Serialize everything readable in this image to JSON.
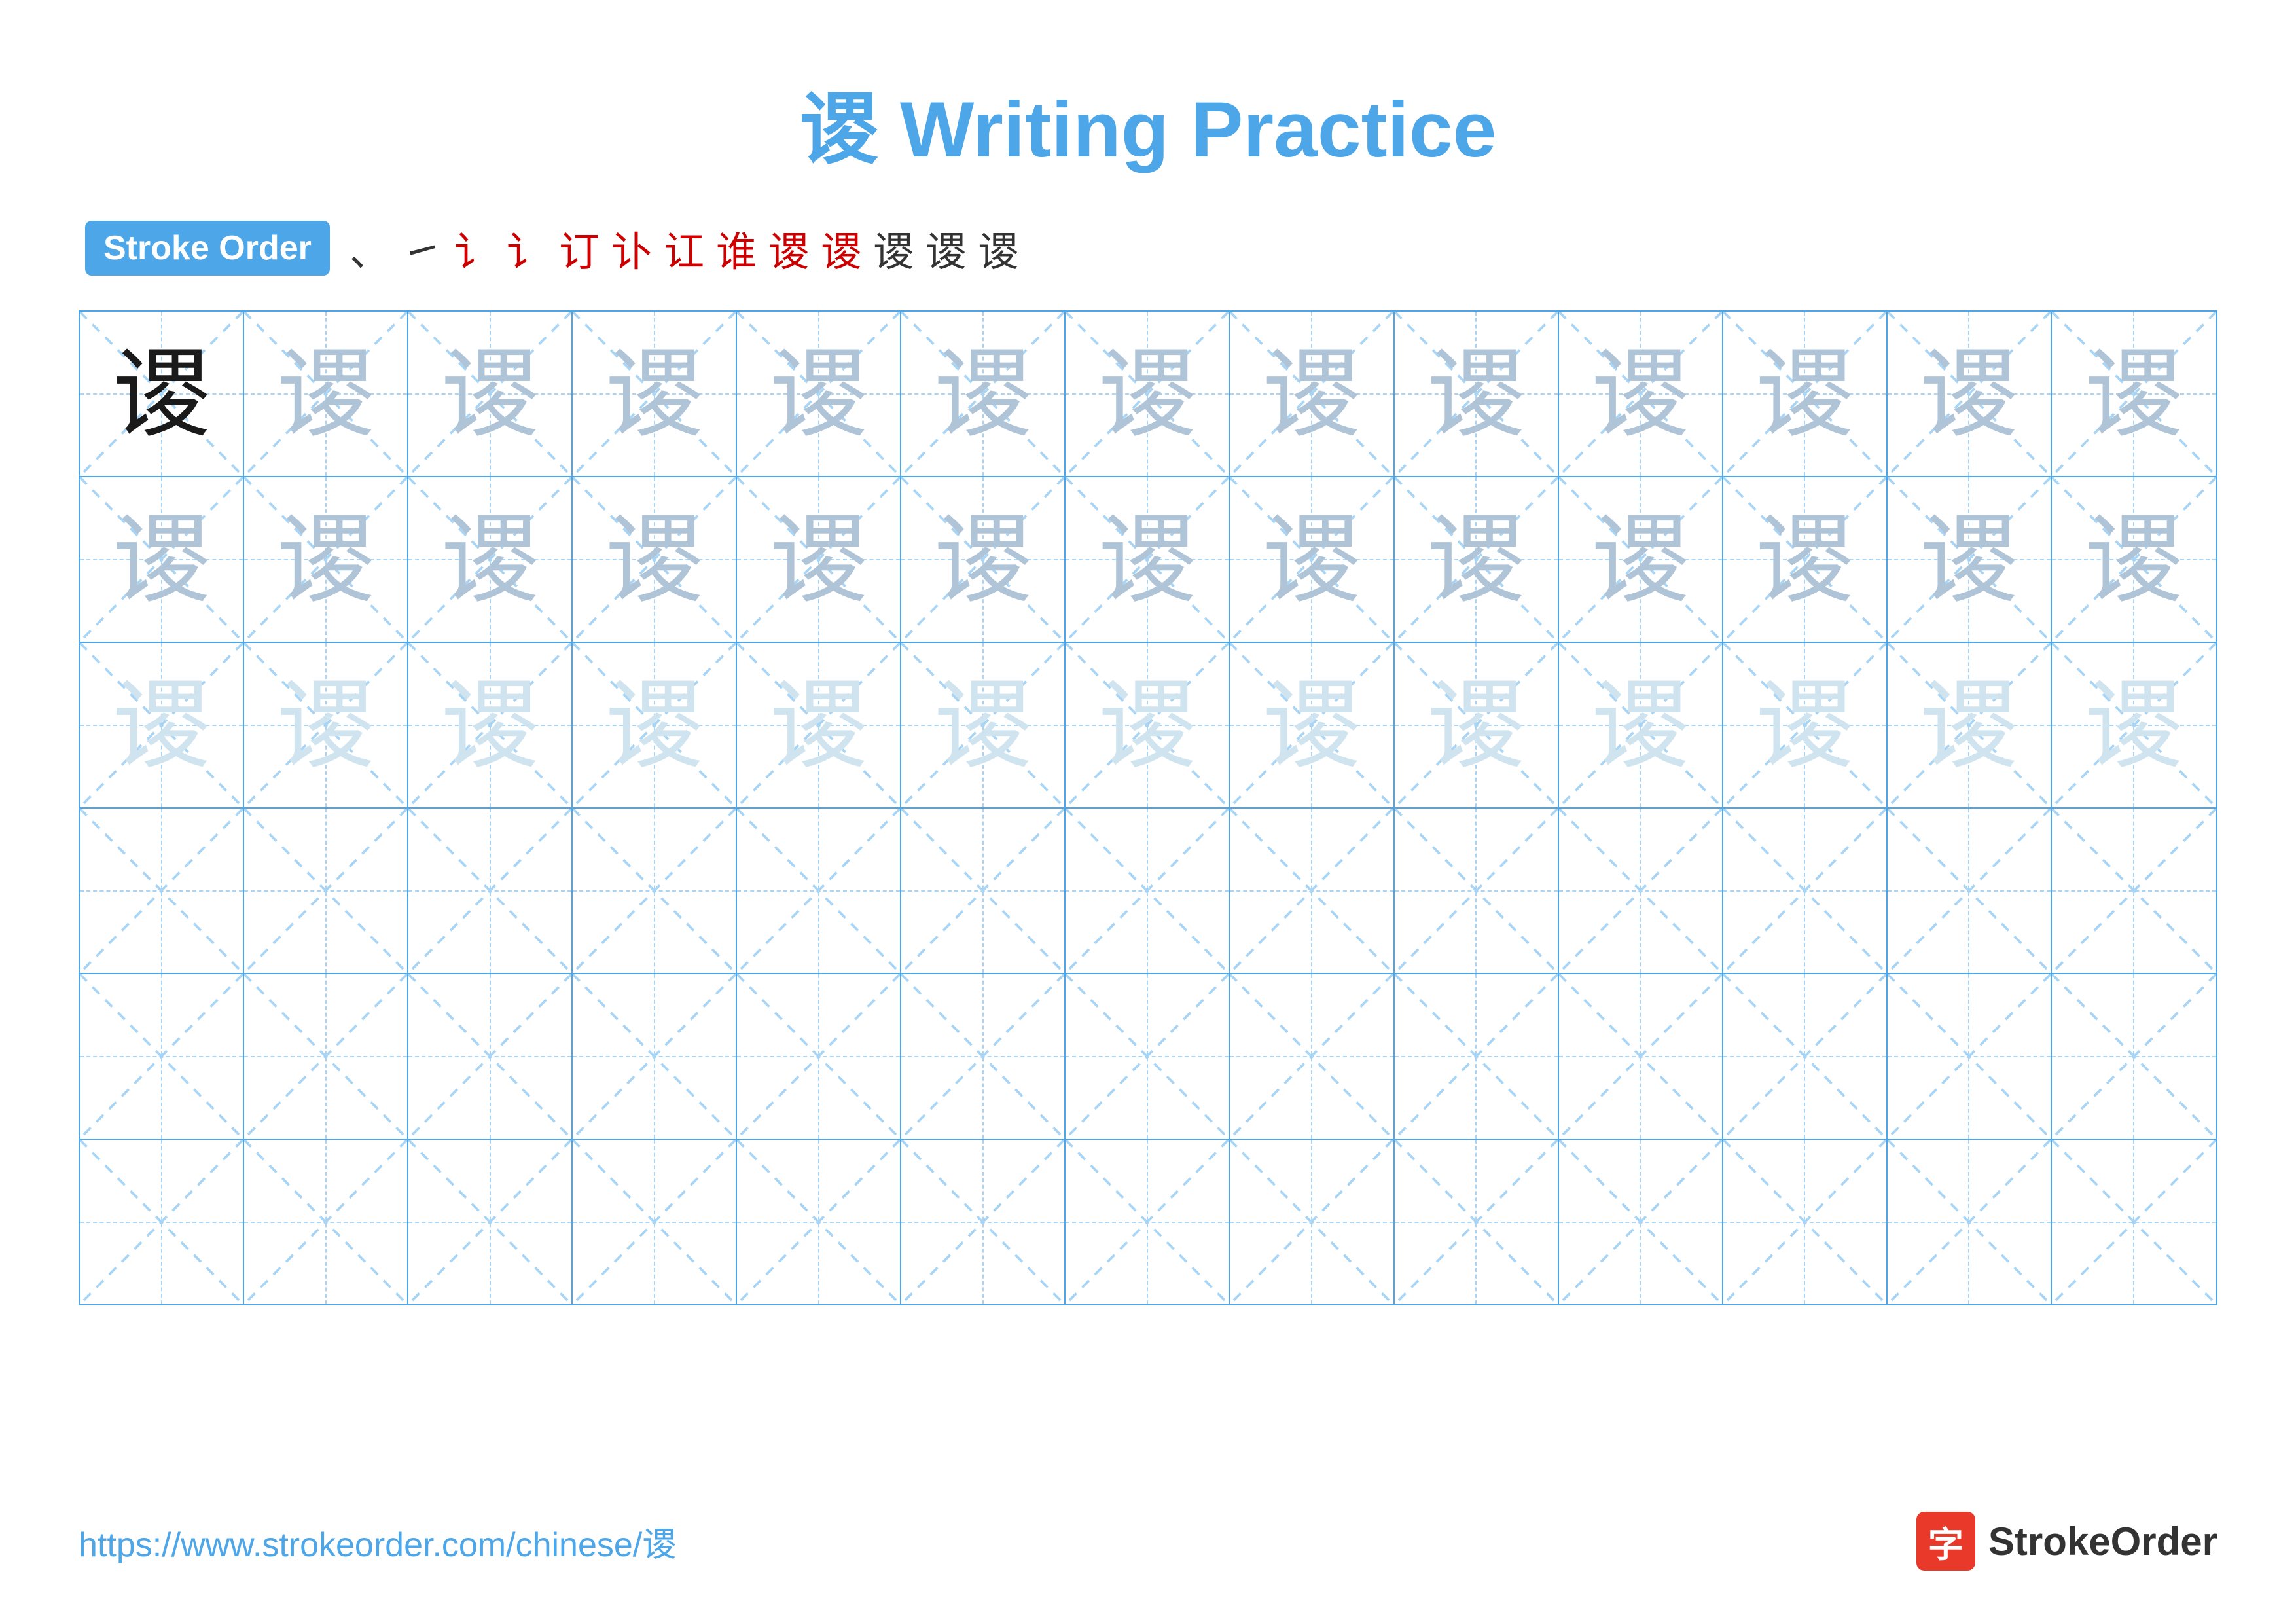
{
  "title": "谡 Writing Practice",
  "stroke_order_badge": "Stroke Order",
  "stroke_sequence": [
    "、",
    "㇀",
    "讠",
    "讠'",
    "计",
    "计'",
    "计\"",
    "计\"'",
    "谡'",
    "谡''",
    "谡",
    "谡"
  ],
  "character": "谡",
  "footer": {
    "url": "https://www.strokeorder.com/chinese/谡",
    "logo_text": "StrokeOrder"
  },
  "grid": {
    "rows": 6,
    "cols": 13,
    "row_data": [
      [
        "dark",
        "medium",
        "medium",
        "medium",
        "medium",
        "medium",
        "medium",
        "medium",
        "medium",
        "medium",
        "medium",
        "medium",
        "medium"
      ],
      [
        "medium",
        "medium",
        "medium",
        "medium",
        "medium",
        "medium",
        "medium",
        "medium",
        "medium",
        "medium",
        "medium",
        "medium",
        "medium"
      ],
      [
        "light",
        "light",
        "light",
        "light",
        "light",
        "light",
        "light",
        "light",
        "light",
        "light",
        "light",
        "light",
        "light"
      ],
      [
        "empty",
        "empty",
        "empty",
        "empty",
        "empty",
        "empty",
        "empty",
        "empty",
        "empty",
        "empty",
        "empty",
        "empty",
        "empty"
      ],
      [
        "empty",
        "empty",
        "empty",
        "empty",
        "empty",
        "empty",
        "empty",
        "empty",
        "empty",
        "empty",
        "empty",
        "empty",
        "empty"
      ],
      [
        "empty",
        "empty",
        "empty",
        "empty",
        "empty",
        "empty",
        "empty",
        "empty",
        "empty",
        "empty",
        "empty",
        "empty",
        "empty"
      ]
    ]
  },
  "colors": {
    "title": "#4da6e8",
    "badge_bg": "#4da6e8",
    "grid_border": "#4da6e8",
    "guide_dashed": "#a8d4f5",
    "logo_red": "#e8392a"
  }
}
